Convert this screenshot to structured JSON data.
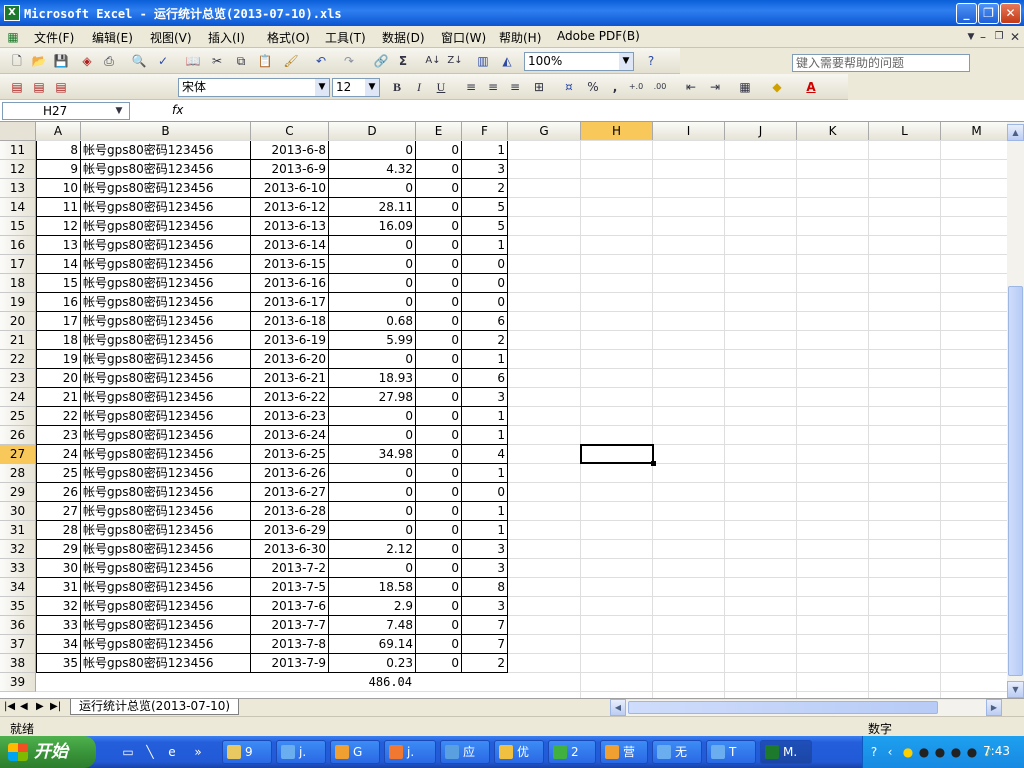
{
  "window": {
    "title": "Microsoft Excel - 运行统计总览(2013-07-10).xls",
    "app_icon": "excel-icon",
    "buttons": {
      "minimize": "_",
      "restore": "❐",
      "close": "✕"
    }
  },
  "menu": {
    "items": [
      "文件(F)",
      "编辑(E)",
      "视图(V)",
      "插入(I)",
      "格式(O)",
      "工具(T)",
      "数据(D)",
      "窗口(W)",
      "帮助(H)",
      "Adobe PDF(B)"
    ],
    "help_placeholder": "键入需要帮助的问题"
  },
  "toolbar": {
    "zoom": "100%",
    "font_name": "宋体",
    "font_size": "12",
    "bold": "B",
    "italic": "I",
    "underline": "U",
    "percent": "%",
    "comma": ",",
    "inc_decimal": "+.0",
    "dec_decimal": ".00"
  },
  "formula_bar": {
    "name_box": "H27",
    "fx": "fx",
    "value": ""
  },
  "columns": [
    "A",
    "B",
    "C",
    "D",
    "E",
    "F",
    "G",
    "H",
    "I",
    "J",
    "K",
    "L",
    "M"
  ],
  "selected_column": "H",
  "selected_row": 27,
  "rows": [
    {
      "n": 11,
      "a": "8",
      "b": "帐号gps80密码123456",
      "c": "2013-6-8",
      "d": "0",
      "e": "0",
      "f": "1"
    },
    {
      "n": 12,
      "a": "9",
      "b": "帐号gps80密码123456",
      "c": "2013-6-9",
      "d": "4.32",
      "e": "0",
      "f": "3"
    },
    {
      "n": 13,
      "a": "10",
      "b": "帐号gps80密码123456",
      "c": "2013-6-10",
      "d": "0",
      "e": "0",
      "f": "2"
    },
    {
      "n": 14,
      "a": "11",
      "b": "帐号gps80密码123456",
      "c": "2013-6-12",
      "d": "28.11",
      "e": "0",
      "f": "5"
    },
    {
      "n": 15,
      "a": "12",
      "b": "帐号gps80密码123456",
      "c": "2013-6-13",
      "d": "16.09",
      "e": "0",
      "f": "5"
    },
    {
      "n": 16,
      "a": "13",
      "b": "帐号gps80密码123456",
      "c": "2013-6-14",
      "d": "0",
      "e": "0",
      "f": "1"
    },
    {
      "n": 17,
      "a": "14",
      "b": "帐号gps80密码123456",
      "c": "2013-6-15",
      "d": "0",
      "e": "0",
      "f": "0"
    },
    {
      "n": 18,
      "a": "15",
      "b": "帐号gps80密码123456",
      "c": "2013-6-16",
      "d": "0",
      "e": "0",
      "f": "0"
    },
    {
      "n": 19,
      "a": "16",
      "b": "帐号gps80密码123456",
      "c": "2013-6-17",
      "d": "0",
      "e": "0",
      "f": "0"
    },
    {
      "n": 20,
      "a": "17",
      "b": "帐号gps80密码123456",
      "c": "2013-6-18",
      "d": "0.68",
      "e": "0",
      "f": "6"
    },
    {
      "n": 21,
      "a": "18",
      "b": "帐号gps80密码123456",
      "c": "2013-6-19",
      "d": "5.99",
      "e": "0",
      "f": "2"
    },
    {
      "n": 22,
      "a": "19",
      "b": "帐号gps80密码123456",
      "c": "2013-6-20",
      "d": "0",
      "e": "0",
      "f": "1"
    },
    {
      "n": 23,
      "a": "20",
      "b": "帐号gps80密码123456",
      "c": "2013-6-21",
      "d": "18.93",
      "e": "0",
      "f": "6"
    },
    {
      "n": 24,
      "a": "21",
      "b": "帐号gps80密码123456",
      "c": "2013-6-22",
      "d": "27.98",
      "e": "0",
      "f": "3"
    },
    {
      "n": 25,
      "a": "22",
      "b": "帐号gps80密码123456",
      "c": "2013-6-23",
      "d": "0",
      "e": "0",
      "f": "1"
    },
    {
      "n": 26,
      "a": "23",
      "b": "帐号gps80密码123456",
      "c": "2013-6-24",
      "d": "0",
      "e": "0",
      "f": "1"
    },
    {
      "n": 27,
      "a": "24",
      "b": "帐号gps80密码123456",
      "c": "2013-6-25",
      "d": "34.98",
      "e": "0",
      "f": "4"
    },
    {
      "n": 28,
      "a": "25",
      "b": "帐号gps80密码123456",
      "c": "2013-6-26",
      "d": "0",
      "e": "0",
      "f": "1"
    },
    {
      "n": 29,
      "a": "26",
      "b": "帐号gps80密码123456",
      "c": "2013-6-27",
      "d": "0",
      "e": "0",
      "f": "0"
    },
    {
      "n": 30,
      "a": "27",
      "b": "帐号gps80密码123456",
      "c": "2013-6-28",
      "d": "0",
      "e": "0",
      "f": "1"
    },
    {
      "n": 31,
      "a": "28",
      "b": "帐号gps80密码123456",
      "c": "2013-6-29",
      "d": "0",
      "e": "0",
      "f": "1"
    },
    {
      "n": 32,
      "a": "29",
      "b": "帐号gps80密码123456",
      "c": "2013-6-30",
      "d": "2.12",
      "e": "0",
      "f": "3"
    },
    {
      "n": 33,
      "a": "30",
      "b": "帐号gps80密码123456",
      "c": "2013-7-2",
      "d": "0",
      "e": "0",
      "f": "3"
    },
    {
      "n": 34,
      "a": "31",
      "b": "帐号gps80密码123456",
      "c": "2013-7-5",
      "d": "18.58",
      "e": "0",
      "f": "8"
    },
    {
      "n": 35,
      "a": "32",
      "b": "帐号gps80密码123456",
      "c": "2013-7-6",
      "d": "2.9",
      "e": "0",
      "f": "3"
    },
    {
      "n": 36,
      "a": "33",
      "b": "帐号gps80密码123456",
      "c": "2013-7-7",
      "d": "7.48",
      "e": "0",
      "f": "7"
    },
    {
      "n": 37,
      "a": "34",
      "b": "帐号gps80密码123456",
      "c": "2013-7-8",
      "d": "69.14",
      "e": "0",
      "f": "7"
    },
    {
      "n": 38,
      "a": "35",
      "b": "帐号gps80密码123456",
      "c": "2013-7-9",
      "d": "0.23",
      "e": "0",
      "f": "2"
    }
  ],
  "total_row": {
    "n": 39,
    "d": "486.04"
  },
  "sheet_tab": "运行统计总览(2013-07-10)",
  "status": {
    "ready": "就绪",
    "mode": "数字"
  },
  "taskbar": {
    "start": "开始",
    "buttons": [
      "9",
      "j.",
      "G",
      "j.",
      "应",
      "优",
      "2",
      "营",
      "无",
      "T",
      "M."
    ],
    "clock": "7:43"
  }
}
